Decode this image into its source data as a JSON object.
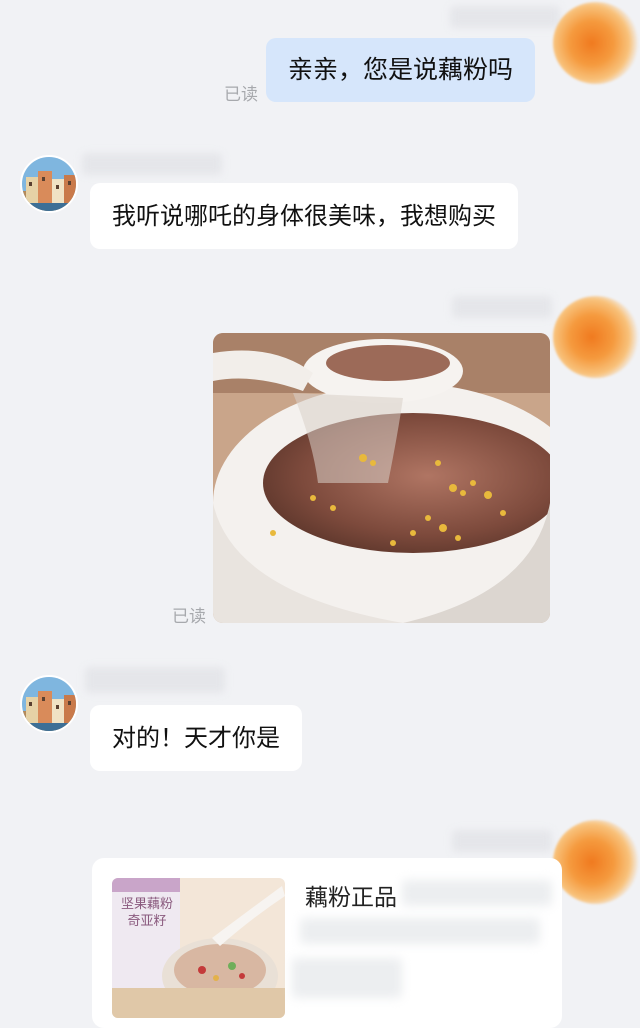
{
  "messages": {
    "m1": {
      "text": "亲亲，您是说藕粉吗",
      "status": "已读"
    },
    "m2": {
      "text": "我听说哪吒的身体很美味，我想购买"
    },
    "m3": {
      "status": "已读"
    },
    "m4": {
      "text": "对的！天才你是"
    },
    "m5": {
      "card_title": "藕粉正品",
      "product_label": "坚果藕粉 奇亚籽"
    }
  },
  "icons": {
    "sender_avatar": "orange-smudge-avatar",
    "contact_avatar": "town-painting-avatar"
  },
  "colors": {
    "background": "#f1f2f5",
    "outgoing_bubble": "#d6e6fb",
    "incoming_bubble": "#ffffff",
    "read_status": "#a7a9ad",
    "smudge_orange": "#f07a1f"
  }
}
